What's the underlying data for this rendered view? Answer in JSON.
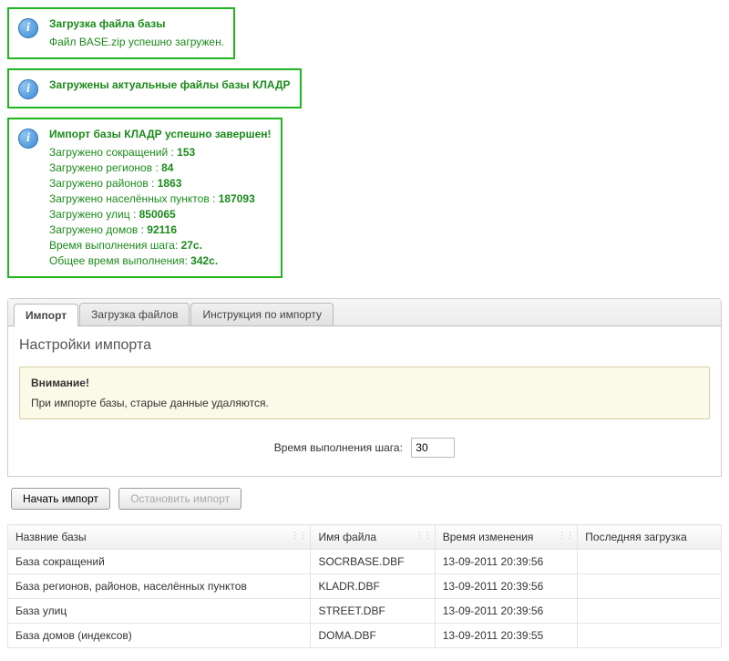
{
  "boxes": {
    "box1": {
      "title": "Загрузка файла базы",
      "subtitle": "Файл BASE.zip успешно загружен."
    },
    "box2": {
      "title": "Загружены актуальные файлы базы КЛАДР"
    },
    "box3": {
      "title": "Импорт базы КЛАДР успешно завершен!",
      "lines": [
        {
          "label": "Загружено сокращений : ",
          "value": "153"
        },
        {
          "label": "Загружено регионов : ",
          "value": "84"
        },
        {
          "label": "Загружено районов : ",
          "value": "1863"
        },
        {
          "label": "Загружено населённых пунктов : ",
          "value": "187093"
        },
        {
          "label": "Загружено улиц : ",
          "value": "850065"
        },
        {
          "label": "Загружено домов : ",
          "value": "92116"
        },
        {
          "label": "Время выполнения шага: ",
          "value": "27с."
        },
        {
          "label": "Общее время выполнения: ",
          "value": "342с."
        }
      ]
    }
  },
  "tabs": {
    "import": "Импорт",
    "upload": "Загрузка файлов",
    "instr": "Инструкция по импорту"
  },
  "panel": {
    "title": "Настройки импорта",
    "warning_title": "Внимание!",
    "warning_text": "При импорте базы, старые данные удаляются.",
    "step_label": "Время выполнения шага:",
    "step_value": "30",
    "start_btn": "Начать импорт",
    "stop_btn": "Остановить импорт"
  },
  "table": {
    "headers": {
      "name": "Назвние базы",
      "file": "Имя файла",
      "mod": "Время изменения",
      "last": "Последняя загрузка"
    },
    "rows": [
      {
        "name": "База сокращений",
        "file": "SOCRBASE.DBF",
        "mod": "13-09-2011 20:39:56",
        "last": ""
      },
      {
        "name": "База регионов, районов, населённых пунктов",
        "file": "KLADR.DBF",
        "mod": "13-09-2011 20:39:56",
        "last": ""
      },
      {
        "name": "База улиц",
        "file": "STREET.DBF",
        "mod": "13-09-2011 20:39:56",
        "last": ""
      },
      {
        "name": "База домов (индексов)",
        "file": "DOMA.DBF",
        "mod": "13-09-2011 20:39:55",
        "last": ""
      }
    ]
  }
}
